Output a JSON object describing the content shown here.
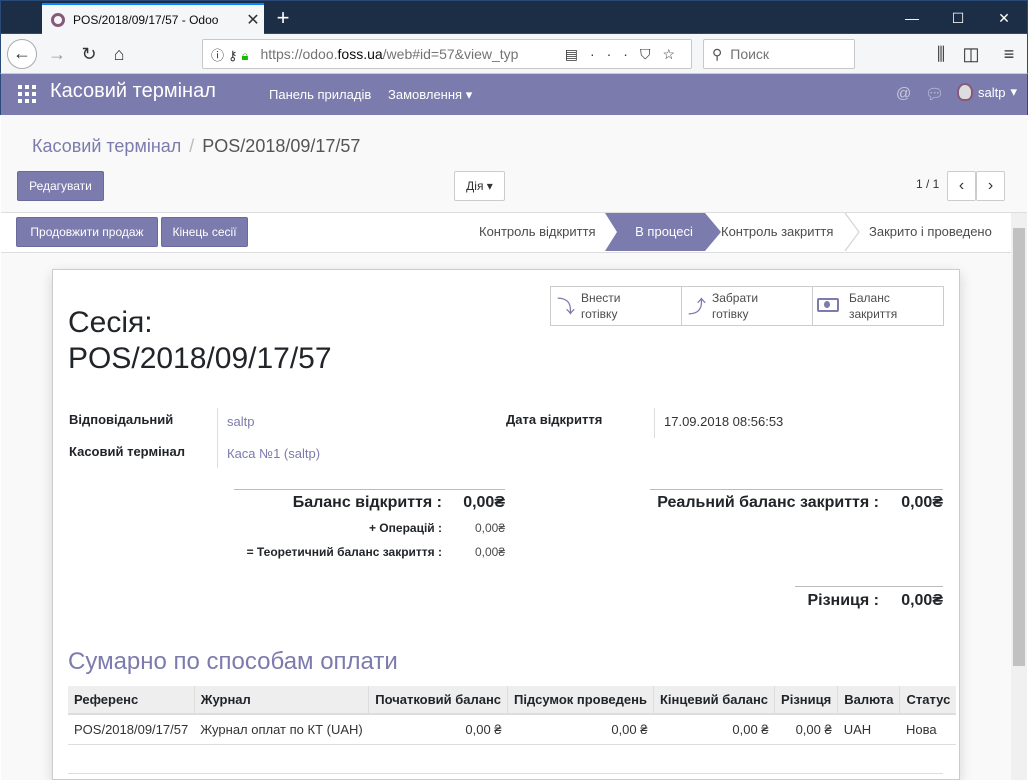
{
  "browser": {
    "tab_title": "POS/2018/09/17/57 - Odoo",
    "url_prefix": "https://odoo.",
    "url_domain": "foss.ua",
    "url_rest": "/web#id=57&view_typ",
    "search_placeholder": "Поиск"
  },
  "app": {
    "name": "Касовий термінал",
    "menu_dashboard": "Панель приладів",
    "menu_orders": "Замовлення",
    "user": "saltp"
  },
  "breadcrumb": {
    "parent": "Касовий термінал",
    "current": "POS/2018/09/17/57"
  },
  "toolbar": {
    "edit": "Редагувати",
    "action": "Дія",
    "pager": "1 / 1"
  },
  "buttons": {
    "continue_sale": "Продовжити продаж",
    "end_session": "Кінець сесії"
  },
  "stages": [
    "Контроль відкриття",
    "В процесі",
    "Контроль закриття",
    "Закрито і проведено"
  ],
  "active_stage": "В процесі",
  "stat_buttons": {
    "cash_in_1": "Внести",
    "cash_in_2": "готівку",
    "cash_out_1": "Забрати",
    "cash_out_2": "готівку",
    "balance_1": "Баланс",
    "balance_2": "закриття"
  },
  "session": {
    "title_1": "Сесія:",
    "title_2": "POS/2018/09/17/57",
    "responsible_label": "Відповідальний",
    "responsible": "saltp",
    "terminal_label": "Касовий термінал",
    "terminal": "Каса №1 (saltp)",
    "opened_label": "Дата відкриття",
    "opened": "17.09.2018 08:56:53"
  },
  "balances": {
    "opening_label": "Баланс відкриття :",
    "opening": "0,00₴",
    "ops_label": "+ Операцій :",
    "ops": "0,00₴",
    "theoretical_label": "= Теоретичний баланс закриття :",
    "theoretical": "0,00₴",
    "real_label": "Реальний баланс закриття :",
    "real": "0,00₴",
    "diff_label": "Різниця :",
    "diff": "0,00₴"
  },
  "payments": {
    "title": "Сумарно по способам оплати",
    "headers": [
      "Референс",
      "Журнал",
      "Початковий баланс",
      "Підсумок проведень",
      "Кінцевий баланс",
      "Різниця",
      "Валюта",
      "Статус"
    ],
    "rows": [
      [
        "POS/2018/09/17/57",
        "Журнал оплат по КТ (UAH)",
        "0,00 ₴",
        "0,00 ₴",
        "0,00 ₴",
        "0,00 ₴",
        "UAH",
        "Нова"
      ]
    ]
  },
  "colors": {
    "brand": "#7c7bad",
    "chrome_dark": "#1c2e45"
  }
}
